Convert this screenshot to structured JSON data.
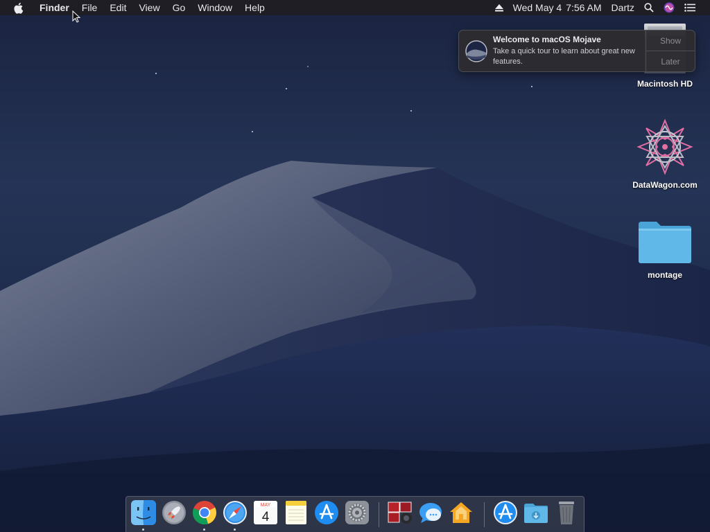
{
  "menubar": {
    "app_name": "Finder",
    "menus": [
      "File",
      "Edit",
      "View",
      "Go",
      "Window",
      "Help"
    ],
    "date": "Wed May 4",
    "time": "7:56 AM",
    "user": "Dartz"
  },
  "notification": {
    "title": "Welcome to macOS Mojave",
    "body": "Take a quick tour to learn about great new features.",
    "show_label": "Show",
    "later_label": "Later"
  },
  "desktop_icons": {
    "hd_label": "Macintosh HD",
    "datawagon_label": "DataWagon.com",
    "folder_label": "montage"
  },
  "dock": {
    "apps": [
      "finder",
      "launchpad",
      "chrome",
      "safari",
      "calendar",
      "notes",
      "app-store",
      "system-preferences",
      "photo-booth",
      "messages",
      "home",
      "app-store",
      "downloads",
      "trash"
    ],
    "calendar_month": "MAY",
    "calendar_day": "4"
  },
  "colors": {
    "accent": "#1e8cf0",
    "folder": "#5fb8e8"
  }
}
